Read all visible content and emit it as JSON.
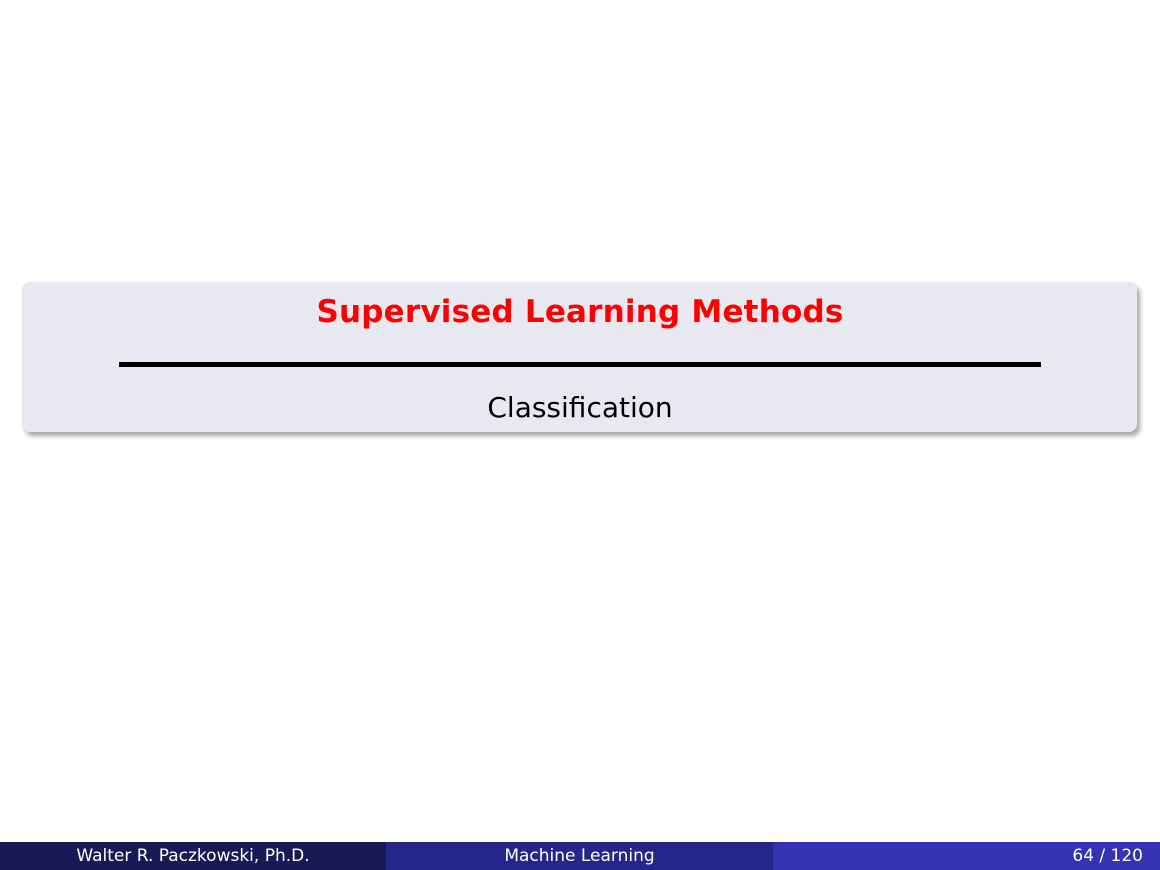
{
  "slide": {
    "section_title": "Supervised Learning Methods",
    "subsection_title": "Classification"
  },
  "footer": {
    "author": "Walter R. Paczkowski, Ph.D.",
    "presentation_title": "Machine Learning",
    "page_number": "64 / 120"
  },
  "colors": {
    "section_title": "#ff0000",
    "title_block_background": "#e8e8f1",
    "footer_left": "#191955",
    "footer_middle": "#26268a",
    "footer_right": "#3333b3"
  }
}
